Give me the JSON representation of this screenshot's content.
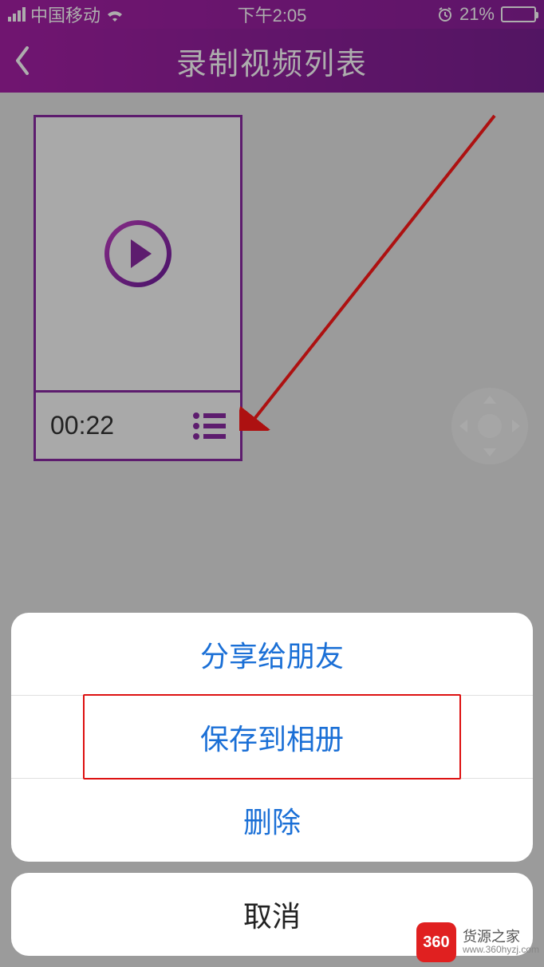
{
  "status_bar": {
    "carrier": "中国移动",
    "time": "下午2:05",
    "battery_percent": "21%"
  },
  "nav": {
    "title": "录制视频列表"
  },
  "video": {
    "duration": "00:22"
  },
  "action_sheet": {
    "items": [
      {
        "label": "分享给朋友",
        "highlighted": false
      },
      {
        "label": "保存到相册",
        "highlighted": true
      },
      {
        "label": "删除",
        "highlighted": false
      }
    ],
    "cancel": "取消"
  },
  "watermark": {
    "badge": "360",
    "title": "货源之家",
    "url": "www.360hyzj.com"
  }
}
